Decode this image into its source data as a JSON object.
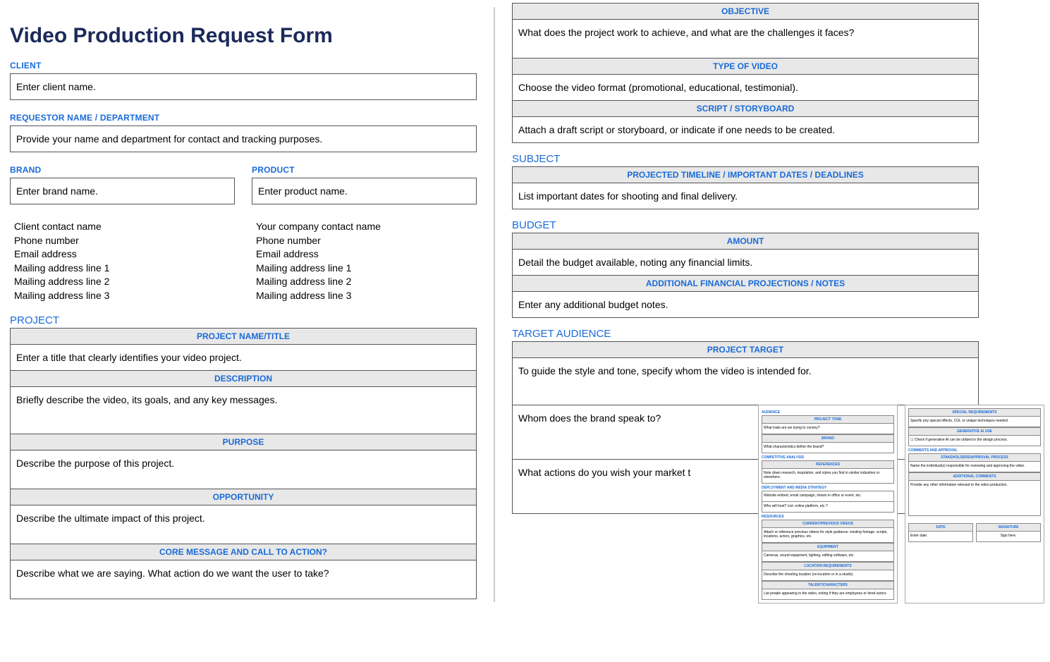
{
  "title": "Video Production Request Form",
  "left": {
    "client_label": "CLIENT",
    "client_text": "Enter client name.",
    "requestor_label": "REQUESTOR NAME / DEPARTMENT",
    "requestor_text": "Provide your name and department for contact and tracking purposes.",
    "brand_label": "BRAND",
    "brand_text": "Enter brand name.",
    "product_label": "PRODUCT",
    "product_text": "Enter product name.",
    "contact_left": [
      "Client contact name",
      "Phone number",
      "Email address",
      "Mailing address line 1",
      "Mailing address line 2",
      "Mailing address line 3"
    ],
    "contact_right": [
      "Your company contact name",
      "Phone number",
      "Email address",
      "Mailing address line 1",
      "Mailing address line 2",
      "Mailing address line 3"
    ],
    "project_label": "PROJECT",
    "rows": [
      {
        "h": "PROJECT NAME/TITLE",
        "t": "Enter a title that clearly identifies your video project."
      },
      {
        "h": "DESCRIPTION",
        "t": "Briefly describe the video, its goals, and any key messages."
      },
      {
        "h": "PURPOSE",
        "t": "Describe the purpose of this project."
      },
      {
        "h": "OPPORTUNITY",
        "t": "Describe the ultimate impact of this project."
      },
      {
        "h": "CORE MESSAGE AND CALL TO ACTION?",
        "t": "Describe what we are saying. What action do we want the user to take?"
      }
    ]
  },
  "right": {
    "top_rows": [
      {
        "h": "OBJECTIVE",
        "t": "What does the project work to achieve, and what are the challenges it faces?"
      },
      {
        "h": "TYPE OF VIDEO",
        "t": "Choose the video format (promotional, educational, testimonial)."
      },
      {
        "h": "SCRIPT / STORYBOARD",
        "t": "Attach a draft script or storyboard, or indicate if one needs to be created."
      }
    ],
    "subject_label": "SUBJECT",
    "subject_rows": [
      {
        "h": "PROJECTED TIMELINE / IMPORTANT DATES / DEADLINES",
        "t": "List important dates for shooting and final delivery."
      }
    ],
    "budget_label": "BUDGET",
    "budget_rows": [
      {
        "h": "AMOUNT",
        "t": "Detail the budget available, noting any financial limits."
      },
      {
        "h": "ADDITIONAL FINANCIAL PROJECTIONS / NOTES",
        "t": "Enter any additional budget notes."
      }
    ],
    "target_label": "TARGET AUDIENCE",
    "target_rows": [
      {
        "h": "PROJECT TARGET",
        "t": "To guide the style and tone, specify whom the video is intended for."
      },
      {
        "h": "",
        "t": "Whom does the brand speak to?"
      },
      {
        "h": "",
        "t": "What actions do you wish your market t"
      }
    ]
  },
  "mini_left": {
    "section1": "AUDIENCE",
    "r1h": "PROJECT TONE",
    "r1t": "What traits are we trying to convey?",
    "r2h": "BRAND",
    "r2t": "What characteristics define the brand?",
    "section2": "COMPETITIVE ANALYSIS",
    "r3h": "REFERENCES",
    "r3t": "Note down research, inspiration, and styles you find in similar industries or elsewhere.",
    "section3": "DEPLOYMENT AND MEDIA STRATEGY",
    "r4t1": "Website embed, email campaign, shown in office or event, etc.",
    "r4t2": "Who will host? List: online platform, etc.?",
    "section4": "RESOURCES",
    "r5h": "CURRENT/PREVIOUS VIDEOS",
    "r5t": "Attach or reference previous videos for style guidance: existing footage, scripts, locations, actors, graphics, etc.",
    "r6h": "EQUIPMENT",
    "r6t": "Cameras, sound equipment, lighting, editing software, etc.",
    "r7h": "LOCATION REQUIREMENTS",
    "r7t": "Describe the shooting location (on-location or in a studio).",
    "r8h": "TALENT/CHARACTERS",
    "r8t": "List people appearing in the video, noting if they are employees or hired actors."
  },
  "mini_right": {
    "r1h": "SPECIAL REQUIREMENTS",
    "r1t": "Specify any special effects, CGI, or unique techniques needed.",
    "r2h": "GENERATIVE AI USE",
    "r2t": "☐ Check if generative AI can be utilized in the design process.",
    "section1": "COMMENTS AND APPROVAL",
    "r3h": "STAKEHOLDERS/APPROVAL PROCESS",
    "r3t": "Name the individual(s) responsible for reviewing and approving the video.",
    "r4h": "ADDITIONAL COMMENTS",
    "r4t": "Provide any other information relevant to the video production.",
    "sig_date_h": "DATE",
    "sig_date_t": "Enter date.",
    "sig_h": "SIGNATURE",
    "sig_t": "Sign here."
  }
}
